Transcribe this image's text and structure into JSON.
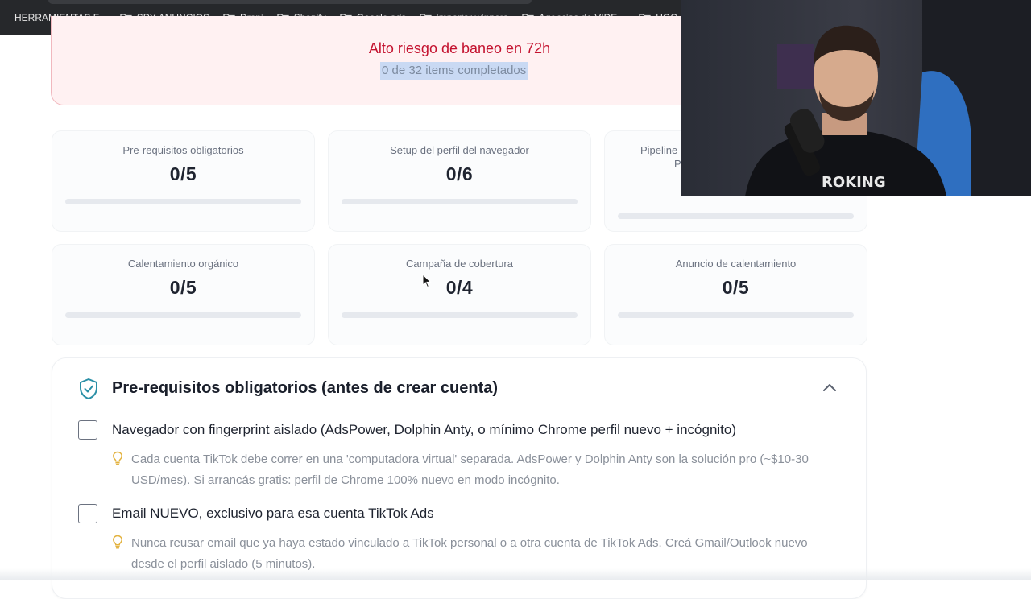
{
  "bookmarks": [
    {
      "label": "HERRAMIENTAS F..."
    },
    {
      "label": "SPY-ANUNCIOS"
    },
    {
      "label": "Dropi"
    },
    {
      "label": "Shopify"
    },
    {
      "label": "Google ads"
    },
    {
      "label": "importar winners"
    },
    {
      "label": "Agencias de VIDE..."
    },
    {
      "label": "UGC AI"
    }
  ],
  "risk": {
    "title": "Alto riesgo de baneo en 72h",
    "progress_text": "0 de 32 items completados"
  },
  "stats": [
    {
      "label": "Pre-requisitos obligatorios",
      "value": "0/5",
      "progress": 0
    },
    {
      "label": "Setup del perfil del navegador",
      "value": "0/6",
      "progress": 0
    },
    {
      "label": "Pipeline",
      "label2": "P",
      "value": "",
      "progress": 0
    },
    {
      "label": "Calentamiento orgánico",
      "value": "0/5",
      "progress": 0
    },
    {
      "label": "Campaña de cobertura",
      "value": "0/4",
      "progress": 0
    },
    {
      "label": "Anuncio de calentamiento",
      "value": "0/5",
      "progress": 0
    }
  ],
  "section": {
    "title": "Pre-requisitos obligatorios (antes de crear cuenta)",
    "items": [
      {
        "title": "Navegador con fingerprint aislado (AdsPower, Dolphin Anty, o mínimo Chrome perfil nuevo + incógnito)",
        "tip": "Cada cuenta TikTok debe correr en una 'computadora virtual' separada. AdsPower y Dolphin Anty son la solución pro (~$10-30 USD/mes). Si arrancás gratis: perfil de Chrome 100% nuevo en modo incógnito.",
        "checked": false
      },
      {
        "title": "Email NUEVO, exclusivo para esa cuenta TikTok Ads",
        "tip": "Nunca reusar email que ya haya estado vinculado a TikTok personal o a otra cuenta de TikTok Ads. Creá Gmail/Outlook nuevo desde el perfil aislado (5 minutos).",
        "checked": false
      }
    ]
  },
  "colors": {
    "risk_red": "#c4122f",
    "accent_teal": "#2a8fa6",
    "selection": "#c9d9f3"
  }
}
